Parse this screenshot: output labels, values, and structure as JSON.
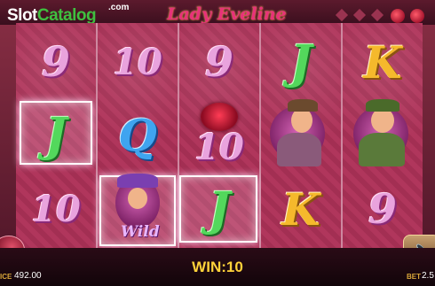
{
  "watermark": {
    "brand_part1": "Slot",
    "brand_part2": "Catalog",
    "domain": ".com"
  },
  "game": {
    "title": "Lady Eveline"
  },
  "reels": [
    [
      "9",
      "J",
      "10"
    ],
    [
      "10",
      "Q",
      "Wild"
    ],
    [
      "9",
      "10",
      "J"
    ],
    [
      "J",
      "character-man-hat",
      "K"
    ],
    [
      "K",
      "character-man-mustache",
      "9"
    ]
  ],
  "winning_positions": [
    {
      "reel": 0,
      "row": 1
    },
    {
      "reel": 1,
      "row": 2
    },
    {
      "reel": 2,
      "row": 2
    }
  ],
  "footer": {
    "win_label": "WIN:",
    "win_value": "10",
    "balance_label": "ICE",
    "balance_value": "492.00",
    "bet_label": "BET",
    "bet_value": "2.5"
  },
  "colors": {
    "win_text": "#ffd23a",
    "title": "#e8317a",
    "reel_bg": "#b0365c"
  },
  "icons": {
    "sound": "speaker-icon"
  }
}
